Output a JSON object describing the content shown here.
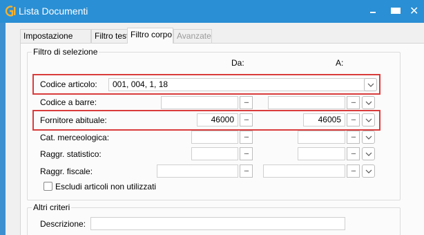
{
  "window": {
    "title": "Lista Documenti",
    "controls": {
      "minimize": "minimize-icon",
      "maximize": "maximize-icon",
      "close": "close-icon"
    },
    "accent_color": "#2a8fd4",
    "highlight_color": "#d93b3b"
  },
  "tabs": [
    {
      "label": "Impostazione",
      "state": "normal"
    },
    {
      "label": "Filtro testata",
      "state": "normal"
    },
    {
      "label": "Filtro corpo",
      "state": "selected"
    },
    {
      "label": "Avanzate",
      "state": "disabled"
    }
  ],
  "filter": {
    "legend": "Filtro di selezione",
    "col_from": "Da:",
    "col_to": "A:",
    "browse_label": "...",
    "rows": [
      {
        "label": "Codice articolo:",
        "value": "001, 004, 1, 18"
      },
      {
        "label": "Codice a barre:",
        "from": "",
        "to": ""
      },
      {
        "label": "Fornitore abituale:",
        "from": "46000",
        "to": "46005"
      },
      {
        "label": "Cat. merceologica:",
        "from": "",
        "to": ""
      },
      {
        "label": "Raggr. statistico:",
        "from": "",
        "to": ""
      },
      {
        "label": "Raggr. fiscale:",
        "from": "",
        "to": ""
      }
    ],
    "exclude_checkbox": {
      "label": "Escludi articoli non utilizzati",
      "checked": false
    }
  },
  "other": {
    "legend": "Altri criteri",
    "description_label": "Descrizione:",
    "description_value": ""
  }
}
